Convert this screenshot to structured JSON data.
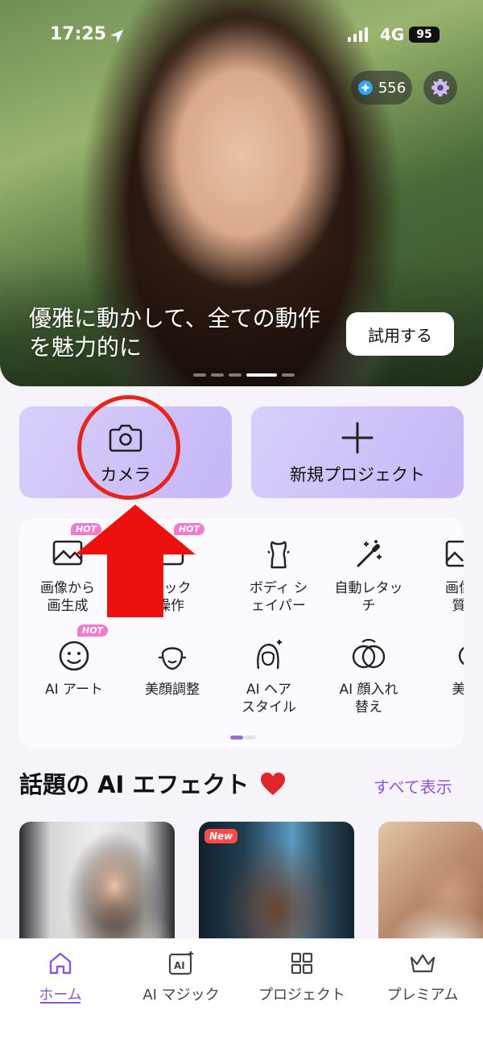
{
  "status_bar": {
    "time": "17:25",
    "network": "4G",
    "battery": "95"
  },
  "header": {
    "coins": "556"
  },
  "hero": {
    "caption": "優雅に動かして、全ての動作を魅力的に",
    "cta": "試用する"
  },
  "actions": {
    "camera": "カメラ",
    "new_project": "新規プロジェクト"
  },
  "tools": {
    "hot_label": "HOT",
    "row1": [
      {
        "label": "画像から\n画生成",
        "icon": "image-to-image-icon"
      },
      {
        "label": "イック\n操作",
        "icon": "quick-edit-icon"
      },
      {
        "label": "ボディ シ\nェイパー",
        "icon": "body-shaper-icon"
      },
      {
        "label": "自動レタッ\nチ",
        "icon": "auto-retouch-icon"
      },
      {
        "label": "画像\n質",
        "icon": "image-quality-icon"
      }
    ],
    "row2": [
      {
        "label": "AI アート",
        "icon": "ai-art-icon"
      },
      {
        "label": "美顔調整",
        "icon": "face-beauty-icon"
      },
      {
        "label": "AI ヘア\nスタイル",
        "icon": "ai-hairstyle-icon"
      },
      {
        "label": "AI 顔入れ\n替え",
        "icon": "face-swap-icon"
      },
      {
        "label": "美",
        "icon": "beauty-icon"
      }
    ]
  },
  "section": {
    "title": "話題の AI エフェクト",
    "see_all": "すべて表示",
    "new_badge": "New"
  },
  "nav": {
    "home": "ホーム",
    "ai_magic": "AI マジック",
    "projects": "プロジェクト",
    "premium": "プレミアム"
  },
  "colors": {
    "accent": "#8c56d6",
    "card": "#d3c6f9",
    "annotation": "#e8231c"
  }
}
